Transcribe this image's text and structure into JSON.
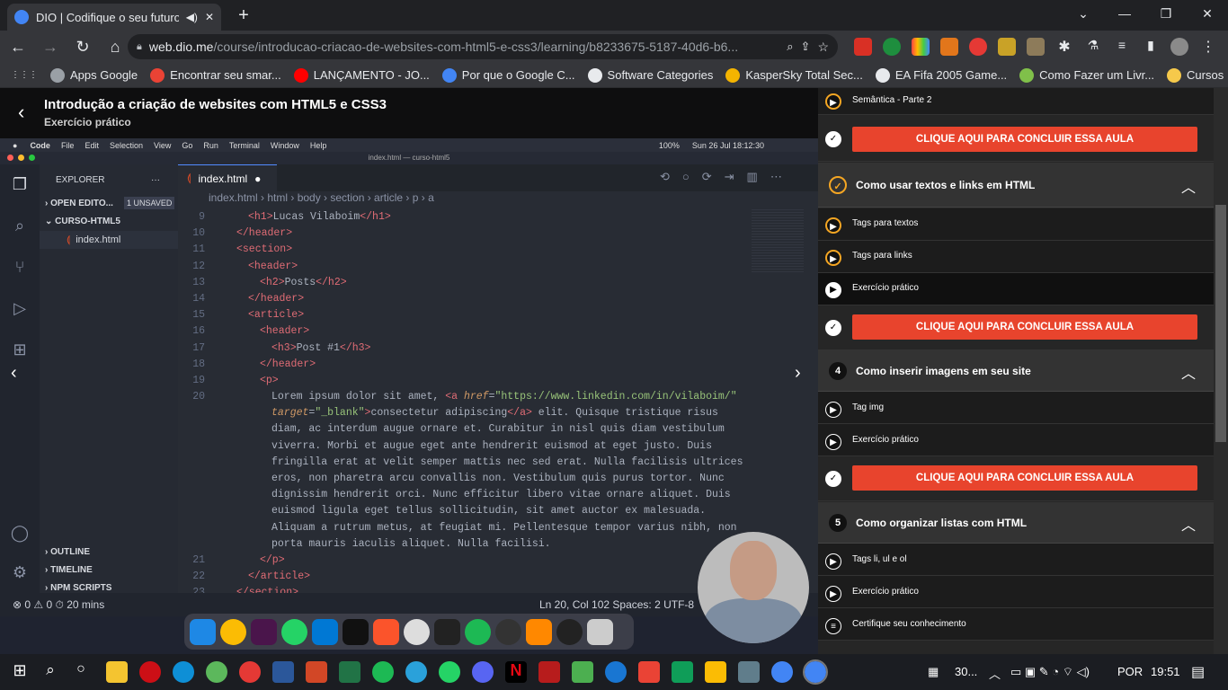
{
  "browser": {
    "tab_title": "DIO | Codifique o seu futuro",
    "url_domain": "web.dio.me",
    "url_path": "/course/introducao-criacao-de-websites-com-html5-e-css3/learning/b8233675-5187-40d6-b6..."
  },
  "bookmarks": [
    {
      "label": "Apps Google",
      "color": "#9aa0a6"
    },
    {
      "label": "Encontrar seu smar...",
      "color": "#ea4335"
    },
    {
      "label": "LANÇAMENTO - JO...",
      "color": "#ff0000"
    },
    {
      "label": "Por que o Google C...",
      "color": "#4285f4"
    },
    {
      "label": "Software Categories",
      "color": "#e8eaed"
    },
    {
      "label": "KasperSky Total Sec...",
      "color": "#f4b400"
    },
    {
      "label": "EA Fifa 2005 Game...",
      "color": "#e8eaed"
    },
    {
      "label": "Como Fazer um Livr...",
      "color": "#80c04a"
    },
    {
      "label": "Cursos",
      "color": "#f6c94b"
    }
  ],
  "course": {
    "title": "Introdução a criação de websites com HTML5 e CSS3",
    "subtitle": "Exercício prático"
  },
  "vscode": {
    "menubar": [
      "Code",
      "File",
      "Edit",
      "Selection",
      "View",
      "Go",
      "Run",
      "Terminal",
      "Window",
      "Help"
    ],
    "clock": "Sun 26 Jul  18:12:30",
    "battery": "100%",
    "window_title": "index.html — curso-html5",
    "explorer_title": "EXPLORER",
    "open_editors": "OPEN EDITO...",
    "unsaved": "1 UNSAVED",
    "folder": "CURSO-HTML5",
    "file": "index.html",
    "outline": "OUTLINE",
    "timeline": "TIMELINE",
    "npm": "NPM SCRIPTS",
    "tab": "index.html",
    "breadcrumb": "index.html  ›  html  ›  body  ›  section  ›  article  ›  p  ›  a",
    "status_left": "⊗ 0 ⚠ 0    ⏱ 20 mins",
    "status_right": "Ln 20, Col 102    Spaces: 2    UTF-8"
  },
  "code_lines": [
    {
      "no": "9",
      "html": "<span class='tg'>&lt;h1&gt;</span>Lucas Vilaboim<span class='tg'>&lt;/h1&gt;</span>",
      "indent": 2
    },
    {
      "no": "10",
      "html": "<span class='tg'>&lt;/header&gt;</span>",
      "indent": 1
    },
    {
      "no": "11",
      "html": "<span class='tg'>&lt;section&gt;</span>",
      "indent": 1
    },
    {
      "no": "12",
      "html": "<span class='tg'>&lt;header&gt;</span>",
      "indent": 2
    },
    {
      "no": "13",
      "html": "<span class='tg'>&lt;h2&gt;</span>Posts<span class='tg'>&lt;/h2&gt;</span>",
      "indent": 3
    },
    {
      "no": "14",
      "html": "<span class='tg'>&lt;/header&gt;</span>",
      "indent": 2
    },
    {
      "no": "15",
      "html": "<span class='tg'>&lt;article&gt;</span>",
      "indent": 2
    },
    {
      "no": "16",
      "html": "<span class='tg'>&lt;header&gt;</span>",
      "indent": 3
    },
    {
      "no": "17",
      "html": "<span class='tg'>&lt;h3&gt;</span>Post #1<span class='tg'>&lt;/h3&gt;</span>",
      "indent": 4
    },
    {
      "no": "18",
      "html": "<span class='tg'>&lt;/header&gt;</span>",
      "indent": 3
    },
    {
      "no": "19",
      "html": "<span class='tg'>&lt;p&gt;</span>",
      "indent": 3
    },
    {
      "no": "20",
      "html": "Lorem ipsum dolor sit amet, <span class='tg'>&lt;a</span> <span class='at'>href</span>=<span class='st'>\"https://www.linkedin.com/in/vilaboim/\"</span>",
      "indent": 4
    },
    {
      "no": "",
      "html": "<span class='at'>target</span>=<span class='st'>\"_blank\"</span><span class='tg'>&gt;</span>consectetur adipiscing<span class='tg'>&lt;/a&gt;</span> elit. Quisque tristique risus",
      "indent": 4
    },
    {
      "no": "",
      "html": "diam, ac interdum augue ornare et. Curabitur in nisl quis diam vestibulum",
      "indent": 4
    },
    {
      "no": "",
      "html": "viverra. Morbi et augue eget ante hendrerit euismod at eget justo. Duis",
      "indent": 4
    },
    {
      "no": "",
      "html": "fringilla erat at velit semper mattis nec sed erat. Nulla facilisis ultrices",
      "indent": 4
    },
    {
      "no": "",
      "html": "eros, non pharetra arcu convallis non. Vestibulum quis purus tortor. Nunc",
      "indent": 4
    },
    {
      "no": "",
      "html": "dignissim hendrerit orci. Nunc efficitur libero vitae ornare aliquet. Duis",
      "indent": 4
    },
    {
      "no": "",
      "html": "euismod ligula eget tellus sollicitudin, sit amet auctor ex malesuada.",
      "indent": 4
    },
    {
      "no": "",
      "html": "Aliquam a rutrum metus, at feugiat mi. Pellentesque tempor varius nibh, non",
      "indent": 4
    },
    {
      "no": "",
      "html": "porta mauris iaculis aliquet. Nulla facilisi.",
      "indent": 4
    },
    {
      "no": "21",
      "html": "<span class='tg'>&lt;/p&gt;</span>",
      "indent": 3
    },
    {
      "no": "22",
      "html": "<span class='tg'>&lt;/article&gt;</span>",
      "indent": 2
    },
    {
      "no": "23",
      "html": "<span class='tg'>&lt;/section&gt;</span>",
      "indent": 1
    }
  ],
  "sidebar": {
    "cta_label": "CLIQUE AQUI PARA CONCLUIR ESSA AULA",
    "items_top": [
      {
        "label": "Semântica - Parte 2",
        "icon": "play-icon"
      }
    ],
    "section3": {
      "title": "Como usar textos e links em HTML",
      "icon": "check-circle-icon"
    },
    "section3_items": [
      {
        "label": "Tags para textos",
        "icon": "play-icon"
      },
      {
        "label": "Tags para links",
        "icon": "play-icon"
      },
      {
        "label": "Exercício prático",
        "icon": "play-icon"
      }
    ],
    "section4": {
      "number": "4",
      "title": "Como inserir imagens em seu site"
    },
    "section4_items": [
      {
        "label": "Tag img",
        "icon": "play-icon"
      },
      {
        "label": "Exercício prático",
        "icon": "play-icon"
      }
    ],
    "section5": {
      "number": "5",
      "title": "Como organizar listas com HTML"
    },
    "section5_items": [
      {
        "label": "Tags li, ul e ol",
        "icon": "play-icon"
      },
      {
        "label": "Exercício prático",
        "icon": "play-icon"
      },
      {
        "label": "Certifique seu conhecimento",
        "icon": "list-icon"
      }
    ]
  },
  "taskbar": {
    "weather": "30...",
    "lang": "POR",
    "time": "19:51"
  },
  "colors": {
    "accent": "#e8442d",
    "progress_orange": "#f5a623"
  }
}
